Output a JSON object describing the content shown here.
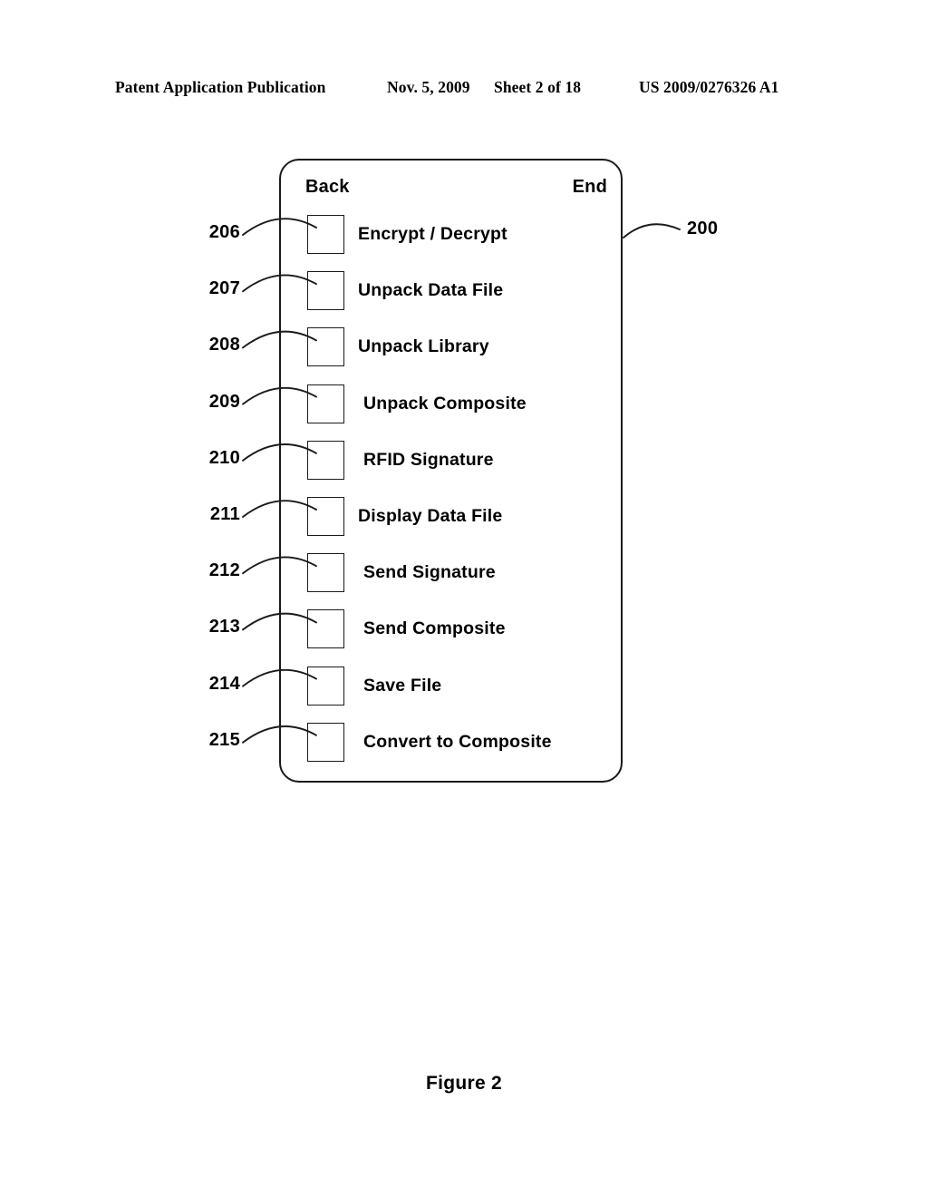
{
  "header": {
    "publication": "Patent Application Publication",
    "date": "Nov. 5, 2009",
    "sheet": "Sheet 2 of 18",
    "publication_number": "US 2009/0276326 A1"
  },
  "figure": {
    "caption": "Figure 2",
    "panel_ref": "200",
    "softkeys": {
      "left": "Back",
      "right": "End"
    },
    "menu_items": [
      {
        "ref": "206",
        "label": "Encrypt / Decrypt",
        "checked": false,
        "indent": 0
      },
      {
        "ref": "207",
        "label": "Unpack Data File",
        "checked": false,
        "indent": 0
      },
      {
        "ref": "208",
        "label": "Unpack  Library",
        "checked": false,
        "indent": 0
      },
      {
        "ref": "209",
        "label": "Unpack  Composite",
        "checked": false,
        "indent": 6
      },
      {
        "ref": "210",
        "label": "RFID Signature",
        "checked": false,
        "indent": 6
      },
      {
        "ref": "211",
        "label": "Display Data File",
        "checked": false,
        "indent": 0
      },
      {
        "ref": "212",
        "label": "Send Signature",
        "checked": false,
        "indent": 6
      },
      {
        "ref": "213",
        "label": "Send  Composite",
        "checked": false,
        "indent": 6
      },
      {
        "ref": "214",
        "label": "Save File",
        "checked": false,
        "indent": 6
      },
      {
        "ref": "215",
        "label": "Convert to Composite",
        "checked": false,
        "indent": 6
      }
    ]
  },
  "colors": {
    "ink": "#1a1a1a",
    "page": "#ffffff"
  }
}
